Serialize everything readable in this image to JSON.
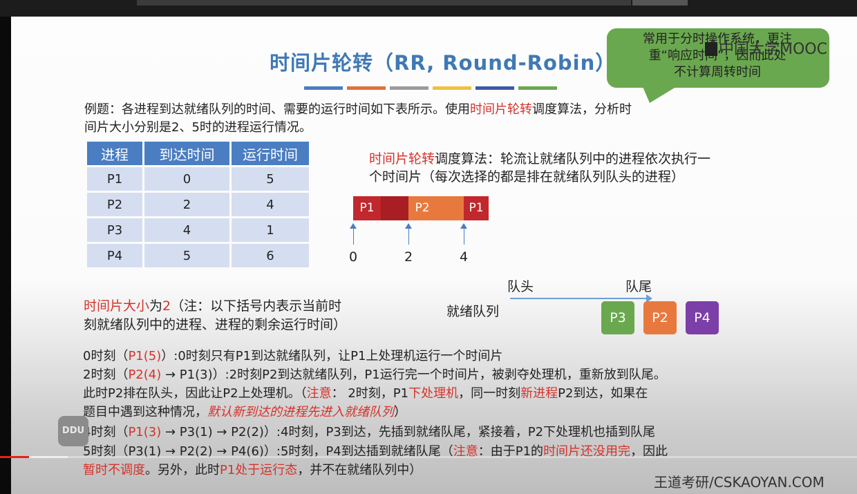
{
  "slide": {
    "title": "时间片轮转（RR, Round-Robin）",
    "stripe_colors": [
      "#4a7dc1",
      "#e2703b",
      "#9b9b9b",
      "#f0c040",
      "#3c5aa6",
      "#6aa84f"
    ],
    "bubble": [
      "常用于分时操作系统，更注",
      "重“响应时间”，因而此处",
      "不计算周转时间"
    ],
    "logo": "中国大学MOOC",
    "example_line1_a": "例题：各进程到达就绪队列的时间、需要的运行时间如下表所示。使用",
    "example_line1_red": "时间片轮转",
    "example_line1_b": "调度算法，分析时",
    "example_line2": "间片大小分别是2、5时的进程运行情况。",
    "table": {
      "headers": [
        "进程",
        "到达时间",
        "运行时间"
      ],
      "rows": [
        [
          "P1",
          "0",
          "5"
        ],
        [
          "P2",
          "2",
          "4"
        ],
        [
          "P3",
          "4",
          "1"
        ],
        [
          "P4",
          "5",
          "6"
        ]
      ]
    },
    "algo_red": "时间片轮转",
    "algo_line1": "调度算法：轮流让就绪队列中的进程依次执行一",
    "algo_line2": "个时间片（每次选择的都是排在就绪队列队头的进程）",
    "gantt": {
      "segments": [
        {
          "label": "P1",
          "color": "#c0282d"
        },
        {
          "label": "",
          "color": "#a81e22"
        },
        {
          "label": "P2",
          "color": "#e8793e"
        },
        {
          "label": "",
          "color": "#e8793e"
        },
        {
          "label": "P1",
          "color": "#c0282d"
        }
      ],
      "ticks": [
        "0",
        "2",
        "4"
      ]
    },
    "queue": {
      "head_label": "队头",
      "tail_label": "队尾",
      "name": "就绪队列",
      "items": [
        {
          "label": "P3",
          "color": "#6aa84f"
        },
        {
          "label": "P2",
          "color": "#e8793e"
        },
        {
          "label": "P4",
          "color": "#7c3fa8"
        }
      ]
    },
    "slice_red": "时间片大小",
    "slice_a": "为",
    "slice_num": "2",
    "slice_b": "（注：以下括号内表示当前时",
    "slice_line2": "刻就绪队列中的进程、进程的剩余运行时间）",
    "l1_a": "0时刻（",
    "l1_red": "P1(5)",
    "l1_b": "）:0时刻只有P1到达就绪队列，让P1上处理机运行一个时间片",
    "l2_a": "2时刻（",
    "l2_red": "P2(4)",
    "l2_b": " → P1(3)）:2时刻P2到达就绪队列，P1运行完一个时间片，被剥夺处理机，重新放到队尾。",
    "l3_a": "此时P2排在队头，因此让P2上处理机。（",
    "l3_red1": "注意",
    "l3_b": "： 2时刻，P1",
    "l3_red2": "下处理机",
    "l3_c": "，同一时刻",
    "l3_red3": "新进程",
    "l3_d": "P2到达，如果在",
    "l4_a": "题目中遇到这种情况，",
    "l4_red": "默认新到达的进程先进入就绪队列",
    "l4_b": "）",
    "l5_a": "4时刻（",
    "l5_red": "P1(3)",
    "l5_b": " → P3(1) → P2(2)）:4时刻，P3到达，先插到就绪队尾，紧接着，P2下处理机也插到队尾",
    "l6_a": "5时刻（P3(1) → P2(2) → P4(6)）:5时刻，P4到达插到就绪队尾（",
    "l6_red1": "注意",
    "l6_b": "：由于P1的",
    "l6_red2": "时间片还没用完",
    "l6_c": "，因此",
    "l7_red1": "暂时不调度",
    "l7_a": "。另外，此时",
    "l7_red2": "P1处于运行态",
    "l7_b": "，并不在就绪队列中）",
    "watermark": "DDU",
    "brand": "王道考研/CSKAOYAN.COM"
  }
}
